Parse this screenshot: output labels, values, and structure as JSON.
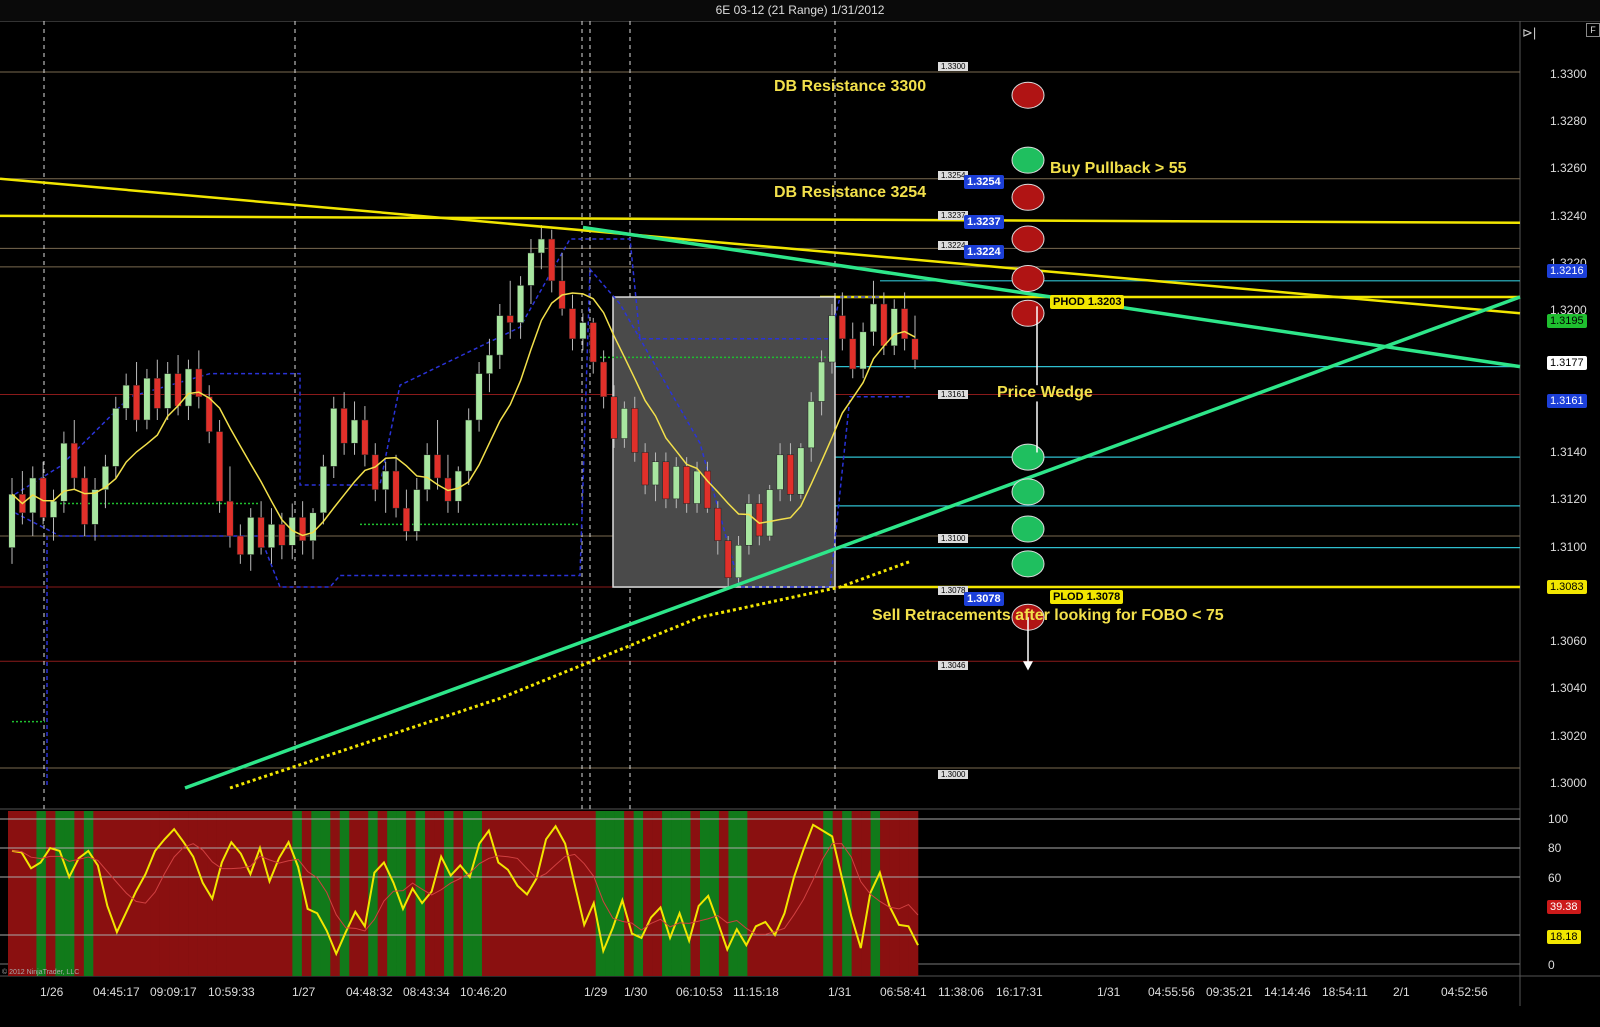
{
  "window": {
    "title": "6E 03-12 (21 Range)  1/31/2012"
  },
  "copyright": "© 2012 NinjaTrader, LLC",
  "chart_data": {
    "type": "candlestick",
    "instrument": "6E 03-12",
    "bar_type": "21 Range",
    "date": "1/31/2012",
    "price_axis": {
      "ticks": [
        "1.3300",
        "1.3280",
        "1.3260",
        "1.3240",
        "1.3220",
        "1.3200",
        "1.3140",
        "1.3120",
        "1.3100",
        "1.3060",
        "1.3040",
        "1.3020",
        "1.3000"
      ],
      "ylim": [
        1.2985,
        1.3315
      ]
    },
    "price_flags": [
      {
        "value": "1.3216",
        "color": "#1c3fd8"
      },
      {
        "value": "1.3195",
        "color": "#1fbf2f"
      },
      {
        "value": "1.3177",
        "color": "#ffffff"
      },
      {
        "value": "1.3161",
        "color": "#1c3fd8"
      },
      {
        "value": "1.3083",
        "color": "#f2e600"
      }
    ],
    "level_labels": [
      "1.3300",
      "1.3254",
      "1.3237",
      "1.3224",
      "1.3161",
      "1.3100",
      "1.3078",
      "1.3046",
      "1.3000"
    ],
    "blue_level_labels": [
      "1.3254",
      "1.3237",
      "1.3224",
      "1.3078"
    ],
    "line_labels": [
      {
        "text": "PHOD 1.3203",
        "value": 1.3203
      },
      {
        "text": "PLOD 1.3078",
        "value": 1.3078
      }
    ],
    "annotations": [
      "DB Resistance 3300",
      "DB Resistance 3254",
      "Buy Pullback > 55",
      "Price Wedge",
      "Sell Retracements after looking for FOBO < 75"
    ],
    "oscillator": {
      "ticks": [
        "100",
        "80",
        "60",
        "0"
      ],
      "ylim": [
        0,
        100
      ],
      "flags": [
        {
          "value": "39.38",
          "color": "#cc1a1a"
        },
        {
          "value": "18.18",
          "color": "#f2e600"
        }
      ]
    },
    "x_axis_labels": [
      "1/26",
      "04:45:17",
      "09:09:17",
      "10:59:33",
      "1/27",
      "04:48:32",
      "08:43:34",
      "10:46:20",
      "1/29",
      "1/30",
      "06:10:53",
      "11:15:18",
      "1/31",
      "06:58:41",
      "11:38:06",
      "16:17:31",
      "1/31",
      "04:55:56",
      "09:35:21",
      "14:14:46",
      "18:54:11",
      "2/1",
      "04:52:56"
    ],
    "candles": [
      [
        1.3095,
        1.3125,
        1.3088,
        1.3118
      ],
      [
        1.3118,
        1.3128,
        1.3105,
        1.311
      ],
      [
        1.311,
        1.313,
        1.31,
        1.3125
      ],
      [
        1.3125,
        1.3132,
        1.3105,
        1.3108
      ],
      [
        1.3108,
        1.312,
        1.3098,
        1.3115
      ],
      [
        1.3115,
        1.3145,
        1.311,
        1.314
      ],
      [
        1.314,
        1.315,
        1.312,
        1.3125
      ],
      [
        1.3125,
        1.313,
        1.31,
        1.3105
      ],
      [
        1.3105,
        1.3125,
        1.3098,
        1.312
      ],
      [
        1.312,
        1.3135,
        1.3112,
        1.313
      ],
      [
        1.313,
        1.316,
        1.3125,
        1.3155
      ],
      [
        1.3155,
        1.317,
        1.315,
        1.3165
      ],
      [
        1.3165,
        1.3175,
        1.3145,
        1.315
      ],
      [
        1.315,
        1.3172,
        1.3146,
        1.3168
      ],
      [
        1.3168,
        1.3176,
        1.315,
        1.3155
      ],
      [
        1.3155,
        1.3175,
        1.315,
        1.317
      ],
      [
        1.317,
        1.3178,
        1.3152,
        1.3156
      ],
      [
        1.3156,
        1.3176,
        1.315,
        1.3172
      ],
      [
        1.3172,
        1.318,
        1.3155,
        1.316
      ],
      [
        1.316,
        1.3165,
        1.314,
        1.3145
      ],
      [
        1.3145,
        1.315,
        1.311,
        1.3115
      ],
      [
        1.3115,
        1.313,
        1.3095,
        1.31
      ],
      [
        1.31,
        1.3105,
        1.3088,
        1.3092
      ],
      [
        1.3092,
        1.3112,
        1.3085,
        1.3108
      ],
      [
        1.3108,
        1.3115,
        1.3092,
        1.3095
      ],
      [
        1.3095,
        1.3112,
        1.3088,
        1.3105
      ],
      [
        1.3105,
        1.311,
        1.309,
        1.3096
      ],
      [
        1.3096,
        1.3114,
        1.309,
        1.3108
      ],
      [
        1.3108,
        1.3115,
        1.3092,
        1.3098
      ],
      [
        1.3098,
        1.3112,
        1.309,
        1.311
      ],
      [
        1.311,
        1.3135,
        1.3105,
        1.313
      ],
      [
        1.313,
        1.316,
        1.3125,
        1.3155
      ],
      [
        1.3155,
        1.3162,
        1.3135,
        1.314
      ],
      [
        1.314,
        1.3158,
        1.3135,
        1.315
      ],
      [
        1.315,
        1.3156,
        1.313,
        1.3135
      ],
      [
        1.3135,
        1.314,
        1.3115,
        1.312
      ],
      [
        1.312,
        1.3132,
        1.311,
        1.3128
      ],
      [
        1.3128,
        1.3135,
        1.3108,
        1.3112
      ],
      [
        1.3112,
        1.312,
        1.3098,
        1.3102
      ],
      [
        1.3102,
        1.3125,
        1.3098,
        1.312
      ],
      [
        1.312,
        1.314,
        1.3115,
        1.3135
      ],
      [
        1.3135,
        1.315,
        1.312,
        1.3125
      ],
      [
        1.3125,
        1.3135,
        1.311,
        1.3115
      ],
      [
        1.3115,
        1.313,
        1.311,
        1.3128
      ],
      [
        1.3128,
        1.3155,
        1.3122,
        1.315
      ],
      [
        1.315,
        1.3175,
        1.3145,
        1.317
      ],
      [
        1.317,
        1.3185,
        1.3162,
        1.3178
      ],
      [
        1.3178,
        1.32,
        1.3172,
        1.3195
      ],
      [
        1.3195,
        1.321,
        1.3185,
        1.3192
      ],
      [
        1.3192,
        1.3212,
        1.3185,
        1.3208
      ],
      [
        1.3208,
        1.3228,
        1.32,
        1.3222
      ],
      [
        1.3222,
        1.3234,
        1.3215,
        1.3228
      ],
      [
        1.3228,
        1.3232,
        1.3205,
        1.321
      ],
      [
        1.321,
        1.3222,
        1.3195,
        1.3198
      ],
      [
        1.3198,
        1.3204,
        1.318,
        1.3185
      ],
      [
        1.3185,
        1.3196,
        1.318,
        1.3192
      ],
      [
        1.3192,
        1.3194,
        1.317,
        1.3175
      ],
      [
        1.3175,
        1.318,
        1.3155,
        1.316
      ],
      [
        1.316,
        1.3165,
        1.3138,
        1.3142
      ],
      [
        1.3142,
        1.3158,
        1.3138,
        1.3155
      ],
      [
        1.3155,
        1.316,
        1.3132,
        1.3136
      ],
      [
        1.3136,
        1.314,
        1.3118,
        1.3122
      ],
      [
        1.3122,
        1.3136,
        1.3115,
        1.3132
      ],
      [
        1.3132,
        1.3136,
        1.3112,
        1.3116
      ],
      [
        1.3116,
        1.3134,
        1.3112,
        1.313
      ],
      [
        1.313,
        1.3134,
        1.311,
        1.3114
      ],
      [
        1.3114,
        1.3132,
        1.311,
        1.3128
      ],
      [
        1.3128,
        1.3132,
        1.311,
        1.3112
      ],
      [
        1.3112,
        1.3115,
        1.3092,
        1.3098
      ],
      [
        1.3098,
        1.31,
        1.3078,
        1.3082
      ],
      [
        1.3082,
        1.31,
        1.308,
        1.3096
      ],
      [
        1.3096,
        1.3118,
        1.3092,
        1.3114
      ],
      [
        1.3114,
        1.3118,
        1.3096,
        1.31
      ],
      [
        1.31,
        1.3122,
        1.3098,
        1.312
      ],
      [
        1.312,
        1.314,
        1.3115,
        1.3135
      ],
      [
        1.3135,
        1.314,
        1.3115,
        1.3118
      ],
      [
        1.3118,
        1.314,
        1.3116,
        1.3138
      ],
      [
        1.3138,
        1.3162,
        1.3132,
        1.3158
      ],
      [
        1.3158,
        1.318,
        1.3152,
        1.3175
      ],
      [
        1.3175,
        1.32,
        1.317,
        1.3195
      ],
      [
        1.3195,
        1.3205,
        1.318,
        1.3185
      ],
      [
        1.3185,
        1.3192,
        1.3168,
        1.3172
      ],
      [
        1.3172,
        1.3192,
        1.3168,
        1.3188
      ],
      [
        1.3188,
        1.321,
        1.3182,
        1.32
      ],
      [
        1.32,
        1.3205,
        1.3178,
        1.3182
      ],
      [
        1.3182,
        1.3202,
        1.3178,
        1.3198
      ],
      [
        1.3198,
        1.3205,
        1.318,
        1.3185
      ],
      [
        1.3185,
        1.3195,
        1.3172,
        1.3176
      ]
    ],
    "oscillator_values": [
      78,
      77,
      66,
      70,
      80,
      78,
      60,
      73,
      78,
      68,
      40,
      22,
      36,
      50,
      62,
      78,
      86,
      93,
      84,
      74,
      56,
      45,
      70,
      84,
      76,
      62,
      80,
      57,
      73,
      84,
      67,
      38,
      35,
      23,
      7,
      22,
      36,
      26,
      63,
      70,
      56,
      38,
      52,
      42,
      50,
      74,
      61,
      68,
      60,
      83,
      92,
      70,
      65,
      54,
      48,
      59,
      86,
      95,
      83,
      55,
      27,
      42,
      9,
      25,
      44,
      21,
      18,
      32,
      39,
      18,
      35,
      16,
      40,
      47,
      29,
      10,
      24,
      13,
      26,
      29,
      20,
      35,
      60,
      79,
      96,
      92,
      88,
      60,
      33,
      11,
      49,
      63,
      40,
      27,
      26,
      13
    ],
    "histogram_colors": [
      "r",
      "r",
      "r",
      "g",
      "r",
      "g",
      "g",
      "r",
      "g",
      "r",
      "r",
      "r",
      "r",
      "r",
      "r",
      "r",
      "r",
      "r",
      "r",
      "r",
      "r",
      "r",
      "r",
      "r",
      "r",
      "r",
      "r",
      "r",
      "r",
      "r",
      "g",
      "r",
      "g",
      "g",
      "r",
      "g",
      "r",
      "r",
      "g",
      "r",
      "g",
      "g",
      "r",
      "g",
      "r",
      "r",
      "g",
      "r",
      "g",
      "g",
      "r",
      "r",
      "r",
      "r",
      "r",
      "r",
      "r",
      "r",
      "r",
      "r",
      "r",
      "r",
      "g",
      "g",
      "g",
      "r",
      "g",
      "r",
      "r",
      "g",
      "g",
      "g",
      "r",
      "g",
      "g",
      "r",
      "g",
      "g",
      "r",
      "r",
      "r",
      "r",
      "r",
      "r",
      "r",
      "r",
      "g",
      "r",
      "g",
      "r",
      "r",
      "g",
      "r",
      "r",
      "r",
      "r"
    ]
  }
}
